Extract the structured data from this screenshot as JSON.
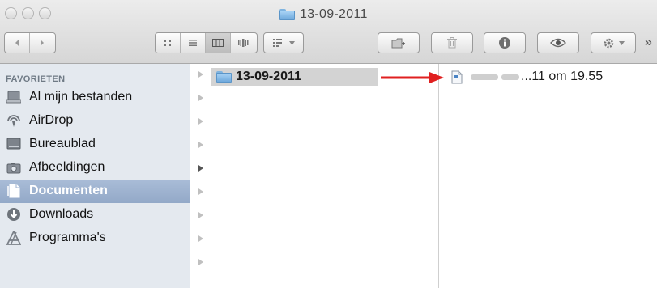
{
  "window": {
    "title": "13-09-2011"
  },
  "toolbar": {
    "back_icon": "chevron-left-icon",
    "forward_icon": "chevron-right-icon",
    "view_icons": [
      "icon-view-icon",
      "list-view-icon",
      "column-view-icon",
      "coverflow-view-icon"
    ],
    "active_view": "column-view",
    "arrange_icon": "arrange-grid-icon",
    "buttons": [
      "new-folder-icon",
      "trash-icon",
      "info-icon",
      "eye-icon",
      "gear-icon"
    ],
    "overflow": "»"
  },
  "sidebar": {
    "header": "FAVORIETEN",
    "items": [
      {
        "label": "Al mijn bestanden",
        "icon": "all-files-icon"
      },
      {
        "label": "AirDrop",
        "icon": "airdrop-icon"
      },
      {
        "label": "Bureaublad",
        "icon": "desktop-icon"
      },
      {
        "label": "Afbeeldingen",
        "icon": "camera-icon"
      },
      {
        "label": "Documenten",
        "icon": "documents-icon",
        "selected": true
      },
      {
        "label": "Downloads",
        "icon": "downloads-icon"
      },
      {
        "label": "Programma's",
        "icon": "applications-icon"
      }
    ]
  },
  "columns": {
    "first": {
      "folder": "13-09-2011"
    },
    "second": {
      "file_name_visible": "...11 om 19.55"
    }
  },
  "colors": {
    "selected_sidebar": "#9db1cf",
    "folder_row_highlight": "#d3d3d3",
    "annotation_arrow": "#e02020"
  }
}
